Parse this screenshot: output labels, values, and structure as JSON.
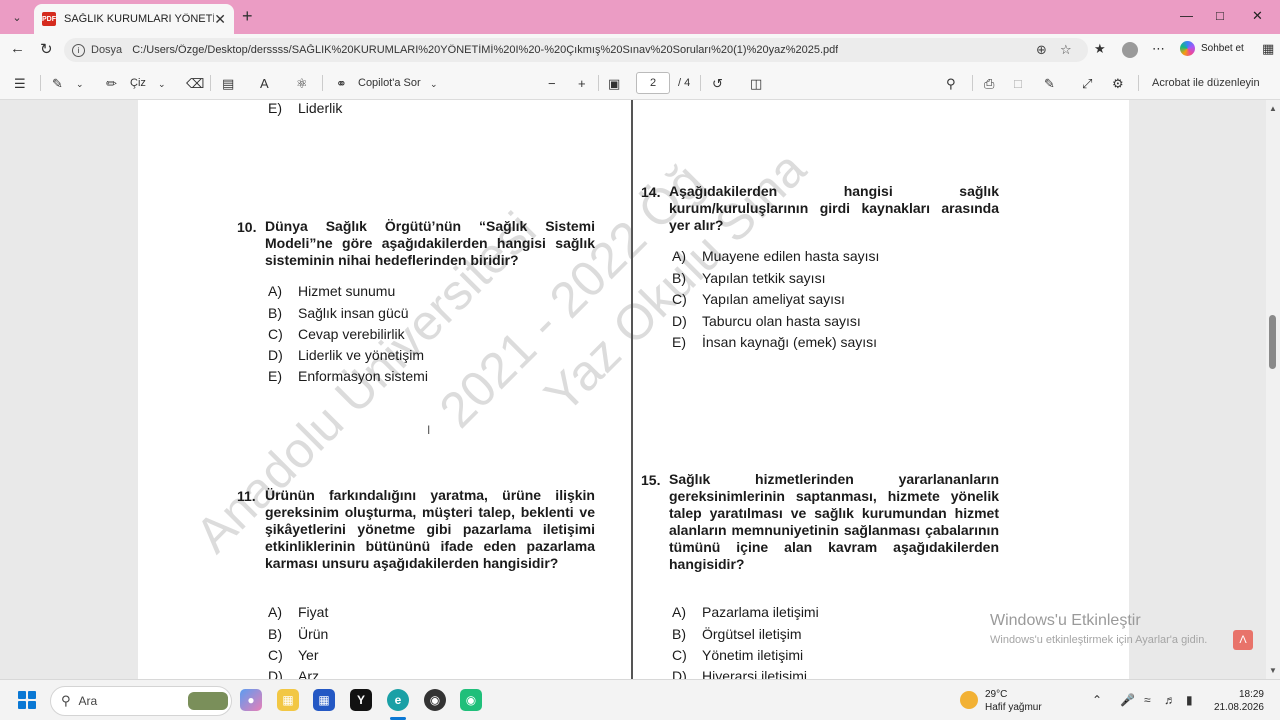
{
  "browser": {
    "tab_title": "SAĞLIK KURUMLARI YÖNETİMİ I -",
    "pdf_badge": "PDF",
    "address_label": "Dosya",
    "url": "C:/Users/Özge/Desktop/derssss/SAĞLIK%20KURUMLARI%20YÖNETİMİ%20I%20-%20Çıkmış%20Sınav%20Soruları%20(1)%20yaz%2025.pdf",
    "chat_label": "Sohbet et"
  },
  "pdf_toolbar": {
    "draw_label": "Çiz",
    "copilot_label": "Copilot'a Sor",
    "current_page": "2",
    "total_pages": "/ 4",
    "edit_label": "Acrobat ile düzenleyin"
  },
  "document": {
    "watermarks": [
      "Anadolu Üniversitesi",
      "2021 - 2022 Öğ",
      "Yaz Okulu Sına"
    ],
    "top_option": {
      "letter": "E)",
      "text": "Liderlik"
    },
    "questions": [
      {
        "number": "10.",
        "text": "Dünya Sağlık Örgütü’nün “Sağlık Sistemi Modeli”ne göre aşağıdakilerden hangisi sağlık sisteminin nihai hedeflerinden biridir?",
        "options": [
          {
            "letter": "A)",
            "text": "Hizmet sunumu"
          },
          {
            "letter": "B)",
            "text": "Sağlık insan gücü"
          },
          {
            "letter": "C)",
            "text": "Cevap verebilirlik"
          },
          {
            "letter": "D)",
            "text": "Liderlik ve yönetişim"
          },
          {
            "letter": "E)",
            "text": "Enformasyon sistemi"
          }
        ]
      },
      {
        "number": "11.",
        "text": "Ürünün farkındalığını yaratma, ürüne ilişkin gereksinim oluşturma, müşteri talep, beklenti ve şikâyetlerini yönetme gibi pazarlama iletişimi etkinliklerinin bütününü ifade eden pazarlama karması unsuru aşağıdakilerden hangisidir?",
        "options": [
          {
            "letter": "A)",
            "text": "Fiyat"
          },
          {
            "letter": "B)",
            "text": "Ürün"
          },
          {
            "letter": "C)",
            "text": "Yer"
          },
          {
            "letter": "D)",
            "text": "Arz"
          }
        ]
      },
      {
        "number": "14.",
        "text": "Aşağıdakilerden hangisi sağlık kurum/kuruluşlarının girdi kaynakları arasında yer alır?",
        "options": [
          {
            "letter": "A)",
            "text": "Muayene edilen hasta sayısı"
          },
          {
            "letter": "B)",
            "text": "Yapılan tetkik sayısı"
          },
          {
            "letter": "C)",
            "text": "Yapılan ameliyat sayısı"
          },
          {
            "letter": "D)",
            "text": "Taburcu olan hasta sayısı"
          },
          {
            "letter": "E)",
            "text": "İnsan kaynağı (emek) sayısı"
          }
        ]
      },
      {
        "number": "15.",
        "text": "Sağlık hizmetlerinden yararlananların gereksinimlerinin saptanması, hizmete yönelik talep yaratılması ve sağlık kurumundan hizmet alanların memnuniyetinin sağlanması çabalarının tümünü içine alan kavram aşağıdakilerden hangisidir?",
        "options": [
          {
            "letter": "A)",
            "text": "Pazarlama iletişimi"
          },
          {
            "letter": "B)",
            "text": "Örgütsel iletişim"
          },
          {
            "letter": "C)",
            "text": "Yönetim iletişimi"
          },
          {
            "letter": "D)",
            "text": "Hiyerarşi iletişimi"
          }
        ]
      }
    ]
  },
  "system": {
    "activate_title": "Windows'u Etkinleştir",
    "activate_sub": "Windows'u etkinleştirmek için Ayarlar'a gidin.",
    "search_placeholder": "Ara",
    "weather_temp": "29°C",
    "weather_desc": "Hafif yağmur",
    "time": "18:29",
    "date": "21.08.2026"
  },
  "colors": {
    "tab_strip": "#eb9cc4",
    "accent": "#0a78d4"
  }
}
